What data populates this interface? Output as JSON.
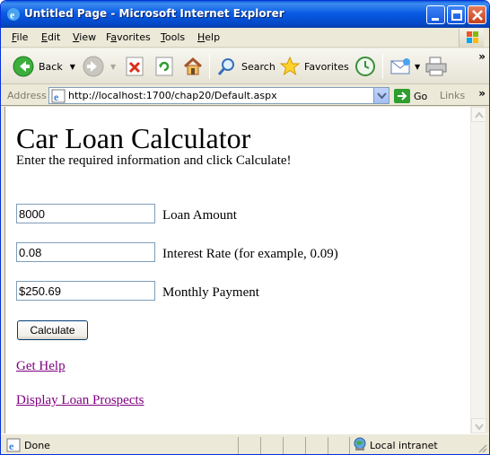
{
  "window": {
    "title": "Untitled Page - Microsoft Internet Explorer"
  },
  "menu": {
    "items": [
      {
        "label": "File",
        "underline": "F",
        "rest": "ile"
      },
      {
        "label": "Edit",
        "underline": "E",
        "rest": "dit"
      },
      {
        "label": "View",
        "underline": "V",
        "rest": "iew"
      },
      {
        "label": "Favorites",
        "underline": "a",
        "pre": "F",
        "rest": "vorites"
      },
      {
        "label": "Tools",
        "underline": "T",
        "rest": "ools"
      },
      {
        "label": "Help",
        "underline": "H",
        "rest": "elp"
      }
    ]
  },
  "toolbar": {
    "back_label": "Back",
    "search_label": "Search",
    "favorites_label": "Favorites"
  },
  "address": {
    "label": "Address",
    "url": "http://localhost:1700/chap20/Default.aspx",
    "go_label": "Go",
    "links_label": "Links"
  },
  "page": {
    "title": "Car Loan Calculator",
    "instructions": "Enter the required information and click Calculate!",
    "loan_amount_value": "8000",
    "loan_amount_label": "Loan Amount",
    "interest_rate_value": "0.08",
    "interest_rate_label": "Interest Rate (for example, 0.09)",
    "monthly_payment_value": "$250.69",
    "monthly_payment_label": "Monthly Payment",
    "calculate_label": "Calculate",
    "help_link": "Get Help",
    "prospects_link": "Display Loan Prospects"
  },
  "status": {
    "text": "Done",
    "zone": "Local intranet"
  },
  "colors": {
    "titlebar": "#0a5ce4",
    "visited_link": "#800080",
    "chrome": "#ece9d8"
  }
}
